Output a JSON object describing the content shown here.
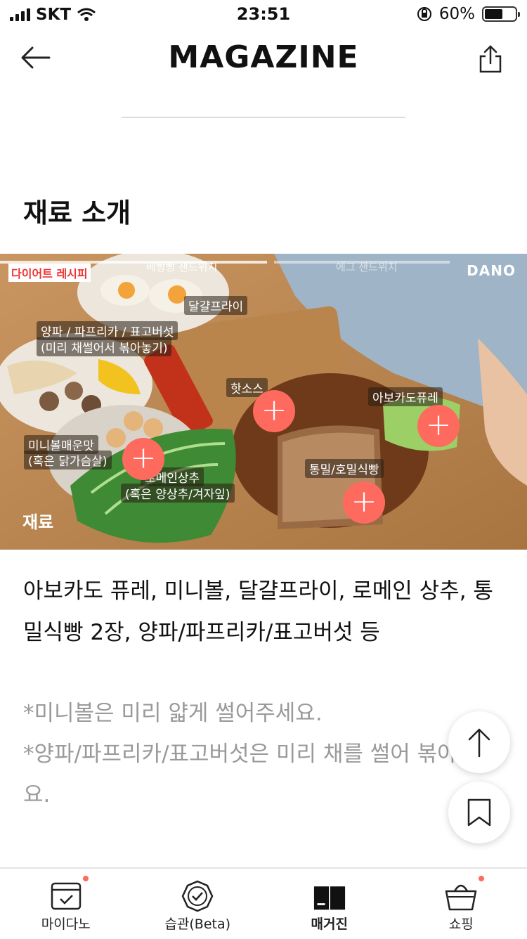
{
  "status_bar": {
    "carrier": "SKT",
    "time": "23:51",
    "battery": "60%",
    "battery_level": 0.6
  },
  "header": {
    "title": "MAGAZINE"
  },
  "section": {
    "title": "재료 소개"
  },
  "image": {
    "brand_badge": "다이어트 레시피",
    "logo": "DANO",
    "segment_1": "베빵빵 샌드위치",
    "segment_2": "에그 샌드위치",
    "caption": "재료",
    "labels": {
      "egg": "달걀프라이",
      "veg_line1": "양파 / 파프리카 / 표고버섯",
      "veg_line2": "(미리 채썰어서 볶아놓기)",
      "hot_sauce": "핫소스",
      "avocado": "아보카도퓨레",
      "miniball_line1": "미니볼매운맛",
      "miniball_line2": "(혹은 닭가슴살)",
      "romaine_line1": "로메인상추",
      "romaine_line2": "(혹은 양상추/겨자잎)",
      "bread": "통밀/호밀식빵"
    }
  },
  "content": {
    "ingredients": "아보카도 퓨레, 미니볼, 달걀프라이, 로메인 상추, 통밀식빵 2장, 양파/파프리카/표고버섯 등",
    "note_1": "*미니볼은 미리 얇게 썰어주세요.",
    "note_2": "*양파/파프리카/표고버섯은 미리 채를 썰어 볶아주세요."
  },
  "nav": {
    "items": [
      {
        "label": "마이다노",
        "icon": "calendar-check-icon"
      },
      {
        "label": "습관(Beta)",
        "icon": "habit-badge-icon"
      },
      {
        "label": "매거진",
        "icon": "book-icon"
      },
      {
        "label": "쇼핑",
        "icon": "shopping-basket-icon"
      }
    ]
  },
  "colors": {
    "accent": "#ff6a5f",
    "text": "#111111",
    "muted": "#9a9a9a"
  }
}
